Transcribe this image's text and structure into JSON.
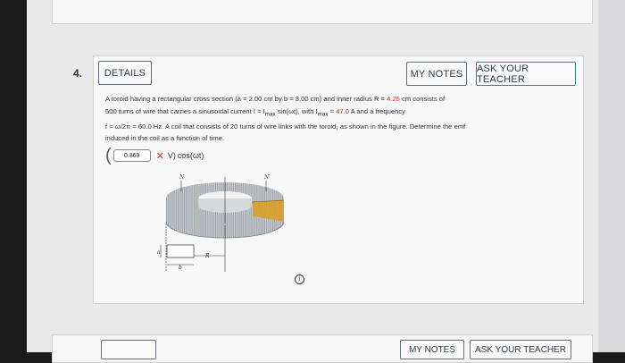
{
  "question": {
    "number": "4.",
    "details_label": "DETAILS",
    "my_notes_label": "MY NOTES",
    "ask_teacher_label": "ASK YOUR TEACHER",
    "line1_a": "A toroid having a rectangular cross section (a = 2.00 cm by b = 3.00 cm) and inner radius R = ",
    "line1_red": "4.25",
    "line1_b": " cm consists of",
    "line2_a": "500 turns of wire that carries a sinusoidal current I = I",
    "line2_sub1": "max",
    "line2_b": " sin(ωt), with I",
    "line2_sub2": "max",
    "line2_c": " = ",
    "line2_red": "47.0",
    "line2_d": " A and a frequency",
    "line3": "f = ω/2π = 60.0 Hz. A coil that consists of 20 turns of wire links with the toroid, as shown in the figure. Determine the emf",
    "line4": "induced in the coil as a function of time."
  },
  "answer": {
    "value": "0.369",
    "status_icon": "✕",
    "unit": "V)",
    "function": "cos(ωt)"
  },
  "figure": {
    "label_n": "N",
    "label_n_prime": "N′",
    "label_r": "R",
    "label_a": "a",
    "label_b": "b"
  },
  "info_icon": "i",
  "next_question": {
    "my_notes_label": "MY NOTES",
    "ask_teacher_label": "ASK YOUR TEACHER"
  },
  "colors": {
    "accent_red": "#c73b2e",
    "button_border": "#5e6e7a"
  }
}
